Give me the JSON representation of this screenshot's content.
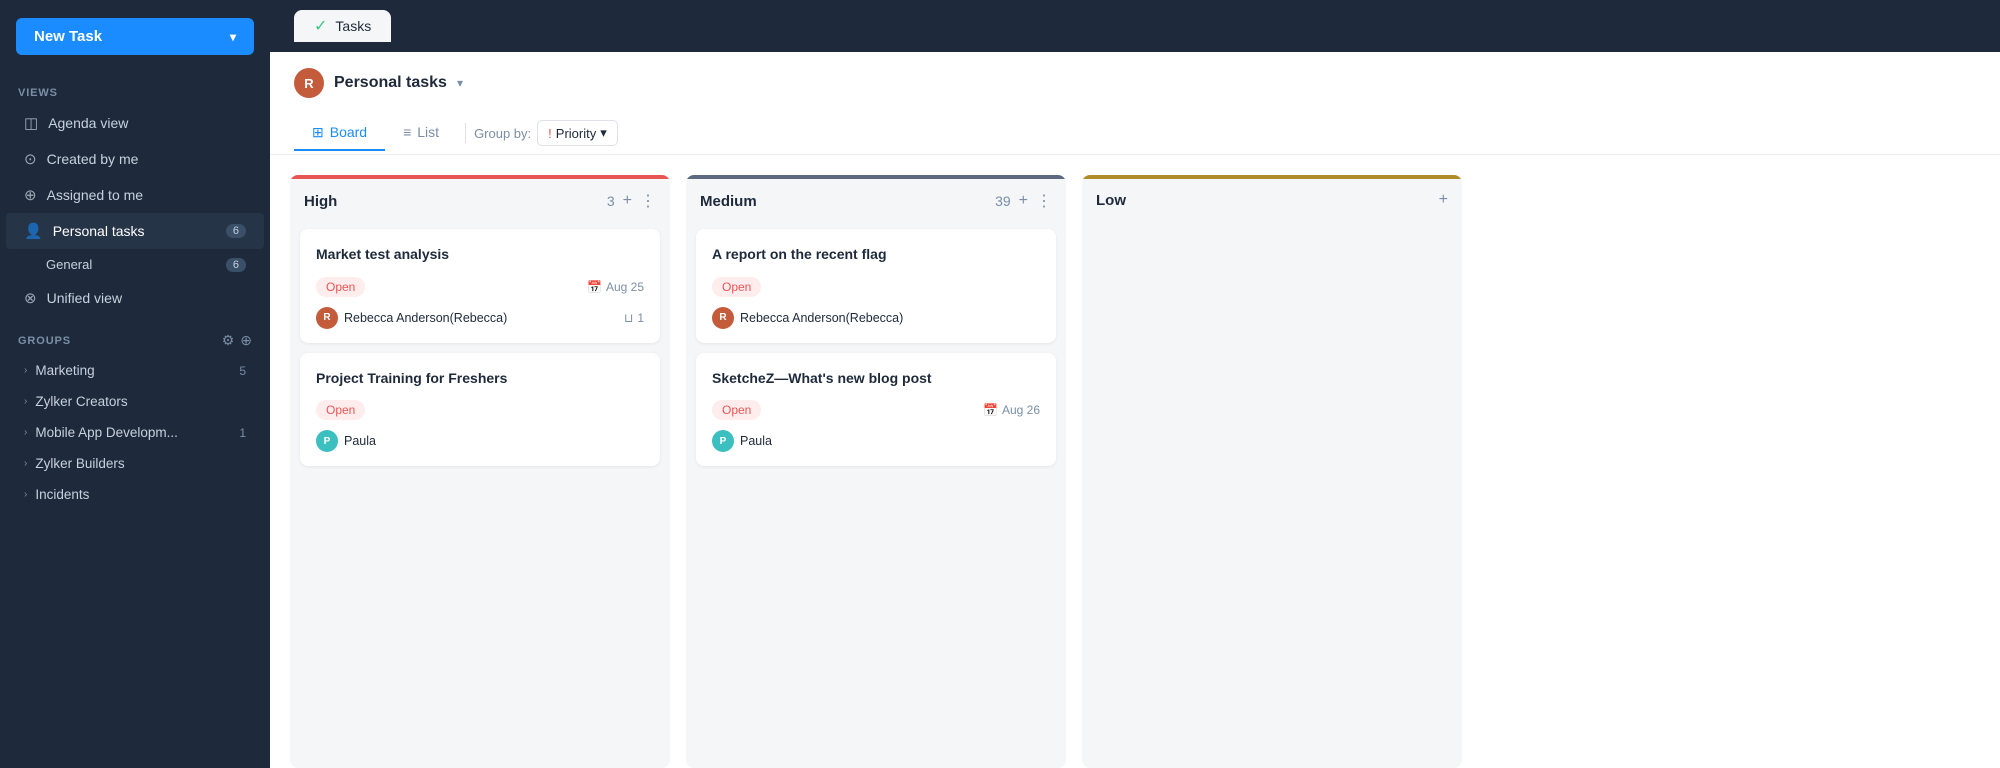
{
  "sidebar": {
    "new_task_label": "New Task",
    "views_label": "VIEWS",
    "items": [
      {
        "id": "agenda-view",
        "label": "Agenda view",
        "icon": "📅"
      },
      {
        "id": "created-by-me",
        "label": "Created by me",
        "icon": "👤"
      },
      {
        "id": "assigned-to-me",
        "label": "Assigned to me",
        "icon": "👥"
      },
      {
        "id": "personal-tasks",
        "label": "Personal tasks",
        "icon": "👤",
        "badge": "6",
        "active": true
      },
      {
        "id": "general",
        "label": "General",
        "icon": "",
        "badge": "6",
        "sub": true
      },
      {
        "id": "unified-view",
        "label": "Unified view",
        "icon": "🔗"
      }
    ],
    "groups_label": "GROUPS",
    "groups": [
      {
        "id": "marketing",
        "label": "Marketing",
        "badge": "5"
      },
      {
        "id": "zylker-creators",
        "label": "Zylker Creators",
        "badge": ""
      },
      {
        "id": "mobile-app",
        "label": "Mobile App Developm...",
        "badge": "1"
      },
      {
        "id": "zylker-builders",
        "label": "Zylker Builders",
        "badge": ""
      },
      {
        "id": "incidents",
        "label": "Incidents",
        "badge": ""
      }
    ]
  },
  "header": {
    "tab_label": "Tasks",
    "personal_tasks_label": "Personal tasks"
  },
  "tabs": [
    {
      "id": "board",
      "label": "Board",
      "active": true
    },
    {
      "id": "list",
      "label": "List",
      "active": false
    }
  ],
  "group_by": {
    "label": "Group by:",
    "value": "Priority"
  },
  "columns": [
    {
      "id": "high",
      "title": "High",
      "count": "3",
      "color_class": "high",
      "cards": [
        {
          "id": "card-1",
          "title": "Market test analysis",
          "status": "Open",
          "due_date": "Aug 25",
          "assignee": "Rebecca Anderson(Rebecca)",
          "subtask_count": "1",
          "avatar_type": "rebecca"
        },
        {
          "id": "card-2",
          "title": "Project Training for Freshers",
          "status": "Open",
          "due_date": "",
          "assignee": "Paula",
          "subtask_count": "",
          "avatar_type": "teal"
        }
      ]
    },
    {
      "id": "medium",
      "title": "Medium",
      "count": "39",
      "color_class": "medium",
      "cards": [
        {
          "id": "card-3",
          "title": "A report on the recent flag",
          "status": "Open",
          "due_date": "",
          "assignee": "Rebecca Anderson(Rebecca)",
          "subtask_count": "",
          "avatar_type": "rebecca"
        },
        {
          "id": "card-4",
          "title": "SketcheZ—What's new blog post",
          "status": "Open",
          "due_date": "Aug 26",
          "assignee": "Paula",
          "subtask_count": "",
          "avatar_type": "teal"
        }
      ]
    },
    {
      "id": "low",
      "title": "Low",
      "count": "",
      "color_class": "low",
      "cards": []
    }
  ]
}
